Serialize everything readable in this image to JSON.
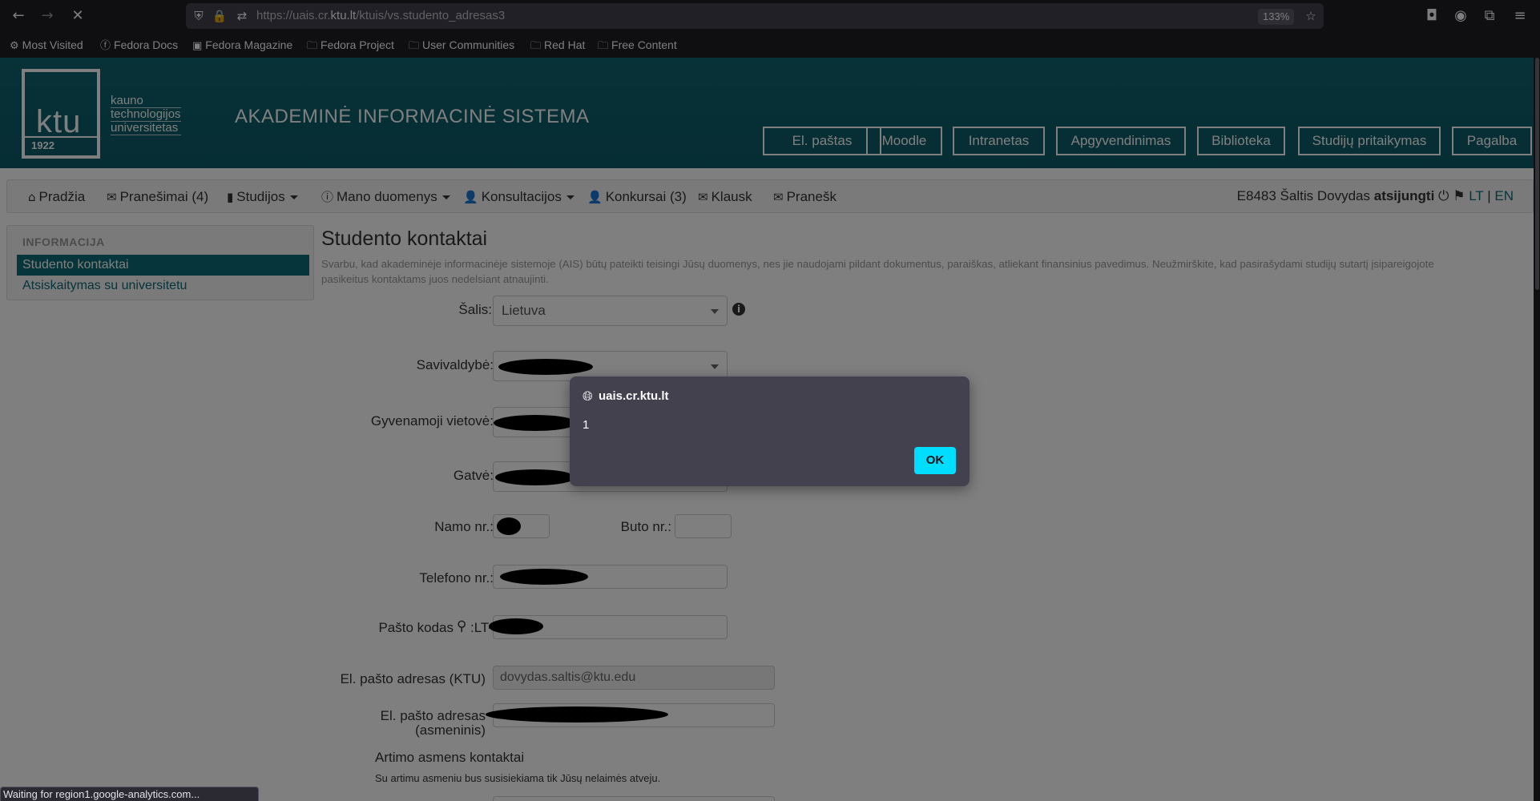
{
  "browser": {
    "url_prefix": "https://uais.cr.",
    "url_domain": "ktu.lt",
    "url_suffix": "/ktuis/vs.studento_adresas3",
    "zoom": "133%",
    "bookmarks": [
      {
        "icon": "gear-icon",
        "label": "Most Visited"
      },
      {
        "icon": "fedora-icon",
        "label": "Fedora Docs"
      },
      {
        "icon": "fm-icon",
        "label": "Fedora Magazine"
      },
      {
        "icon": "folder-icon",
        "label": "Fedora Project"
      },
      {
        "icon": "folder-icon",
        "label": "User Communities"
      },
      {
        "icon": "folder-icon",
        "label": "Red Hat"
      },
      {
        "icon": "folder-icon",
        "label": "Free Content"
      }
    ],
    "status": "Waiting for region1.google-analytics.com..."
  },
  "header": {
    "logo_text": "ktu",
    "logo_words": [
      "kauno",
      "technologijos",
      "universitetas"
    ],
    "logo_year": "1922",
    "title": "AKADEMINĖ INFORMACINĖ SISTEMA",
    "links": [
      "El. paštas",
      "Moodle",
      "Intranetas",
      "Apgyvendinimas",
      "Biblioteka",
      "Studijų pritaikymas",
      "Pagalba"
    ]
  },
  "nav": {
    "items": [
      {
        "icon": "home-icon",
        "label": "Pradžia"
      },
      {
        "icon": "envelope-icon",
        "label": "Pranešimai (4)"
      },
      {
        "icon": "book-icon",
        "label": "Studijos"
      },
      {
        "icon": "info-icon",
        "label": "Mano duomenys"
      },
      {
        "icon": "user-icon",
        "label": "Konsultacijos"
      },
      {
        "icon": "user-icon",
        "label": "Konkursai (3)"
      },
      {
        "icon": "envelope-icon",
        "label": "Klausk"
      },
      {
        "icon": "envelope-icon",
        "label": "Pranešk"
      }
    ],
    "user": "E8483 Šaltis Dovydas",
    "logout": "atsijungti",
    "lang_lt": "LT",
    "lang_sep": "|",
    "lang_en": "EN"
  },
  "sidebar": {
    "heading": "INFORMACIJA",
    "items": [
      "Studento kontaktai",
      "Atsiskaitymas su universitetu"
    ]
  },
  "content": {
    "title": "Studento kontaktai",
    "notice": "Svarbu, kad akademinėje informacinėje sistemoje (AIS) būtų pateikti teisingi Jūsų duomenys, nes jie naudojami pildant dokumentus, paraiškas, atliekant finansinius pavedimus. Neužmirškite, kad pasirašydami studijų sutartį įsipareigojote pasikeitus kontaktams juos nedelsiant atnaujinti.",
    "fields": {
      "country_label": "Šalis:",
      "country_value": "Lietuva",
      "municipality_label": "Savivaldybė:",
      "locality_label": "Gyvenamoji vietovė:",
      "street_label": "Gatvė:",
      "house_label": "Namo nr.:",
      "flat_label": "Buto nr.:",
      "phone_label": "Telefono nr.:",
      "postal_label": "Pašto kodas",
      "postal_prefix": ":LT-",
      "email_ktu_label": "El. pašto adresas (KTU)",
      "email_ktu_value": "dovydas.saltis@ktu.edu",
      "email_personal_label": "El. pašto adresas",
      "email_personal_label2": "(asmeninis)"
    },
    "relative_heading": "Artimo asmens kontaktai",
    "relative_note": "Su artimu asmeniu bus susisiekiama tik Jūsų nelaimės atveju."
  },
  "dialog": {
    "origin": "uais.cr.ktu.lt",
    "message": "1",
    "ok_label": "OK"
  }
}
